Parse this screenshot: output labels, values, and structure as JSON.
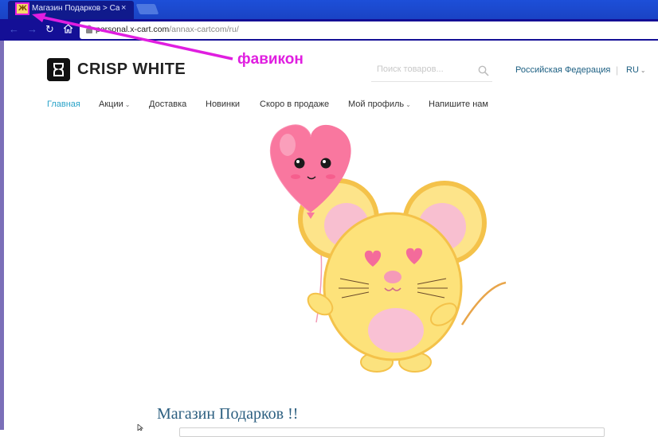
{
  "browser": {
    "tab_title": "Магазин Подарков > Са",
    "tab_close": "×",
    "url_domain": "personal.x-cart.com",
    "url_path": "/annax-cartcom/ru/",
    "nav_icons": [
      "back-icon",
      "forward-icon",
      "reload-icon",
      "home-icon",
      "lock-icon"
    ]
  },
  "header": {
    "logo_text": "CRISP WHITE",
    "search_placeholder": "Поиск товаров...",
    "country": "Российская Федерация",
    "separator": "|",
    "language": "RU"
  },
  "nav": {
    "items": [
      {
        "label": "Главная",
        "active": true
      },
      {
        "label": "Акции",
        "dropdown": true
      },
      {
        "label": "Доставка"
      },
      {
        "label": "Новинки"
      },
      {
        "label": "Скоро в продаже"
      },
      {
        "label": "Мой профиль",
        "dropdown": true
      },
      {
        "label": "Напишите нам"
      }
    ],
    "caret": "⌄"
  },
  "main": {
    "heading": "Магазин Подарков !!"
  },
  "annotation": {
    "label": "фавикон",
    "color": "#e01ee0"
  },
  "colors": {
    "tab_bar": "#1d4fd8",
    "toolbar": "#140f96",
    "nav_active": "#2aa3c8",
    "heading": "#2c5f80",
    "link": "#1c5f82"
  }
}
